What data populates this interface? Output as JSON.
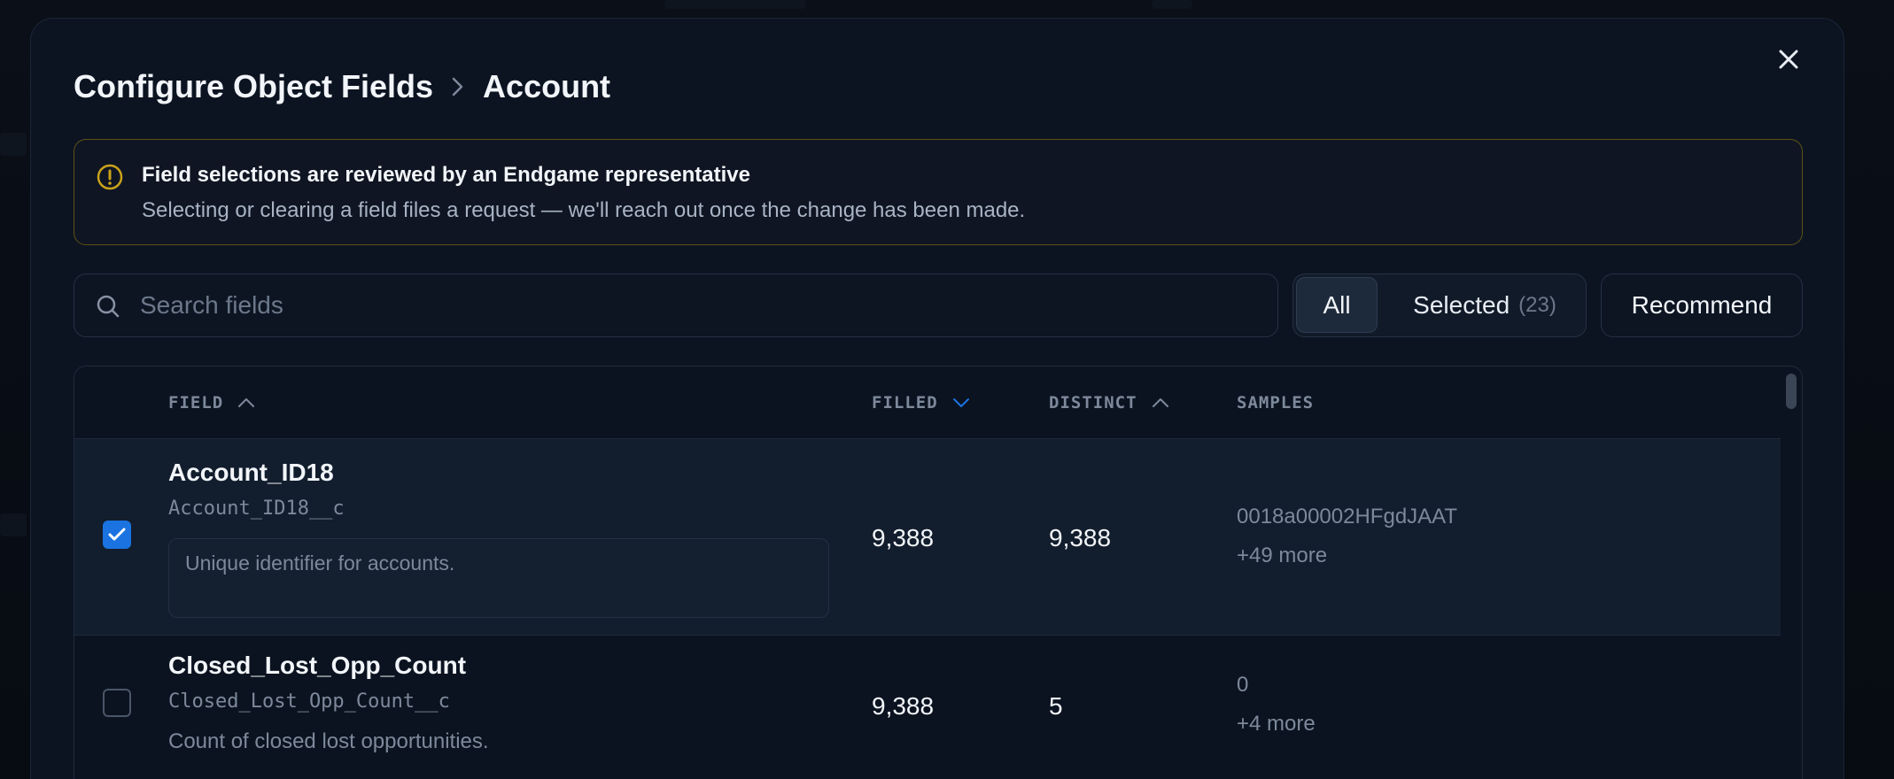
{
  "dialog": {
    "breadcrumb": {
      "root": "Configure Object Fields",
      "current": "Account"
    }
  },
  "notice": {
    "title": "Field selections are reviewed by an Endgame representative",
    "text": "Selecting or clearing a field files a request — we'll reach out once the change has been made."
  },
  "search": {
    "placeholder": "Search fields",
    "value": ""
  },
  "filters": {
    "all_label": "All",
    "selected_label": "Selected",
    "selected_count": "(23)",
    "active": "All"
  },
  "recommend_label": "Recommend",
  "table": {
    "columns": {
      "field": "FIELD",
      "filled": "FILLED",
      "distinct": "DISTINCT",
      "samples": "SAMPLES"
    },
    "rows": [
      {
        "checked": true,
        "name": "Account_ID18",
        "api_name": "Account_ID18__c",
        "description": "Unique identifier for accounts.",
        "filled": "9,388",
        "distinct": "9,388",
        "sample": "0018a00002HFgdJAAT",
        "more": "+49 more"
      },
      {
        "checked": false,
        "name": "Closed_Lost_Opp_Count",
        "api_name": "Closed_Lost_Opp_Count__c",
        "description": "Count of closed lost opportunities.",
        "filled": "9,388",
        "distinct": "5",
        "sample": "0",
        "more": "+4 more"
      }
    ]
  },
  "colors": {
    "accent": "#1a73e0",
    "warning": "#c9a21a",
    "surface": "#0c1422"
  }
}
